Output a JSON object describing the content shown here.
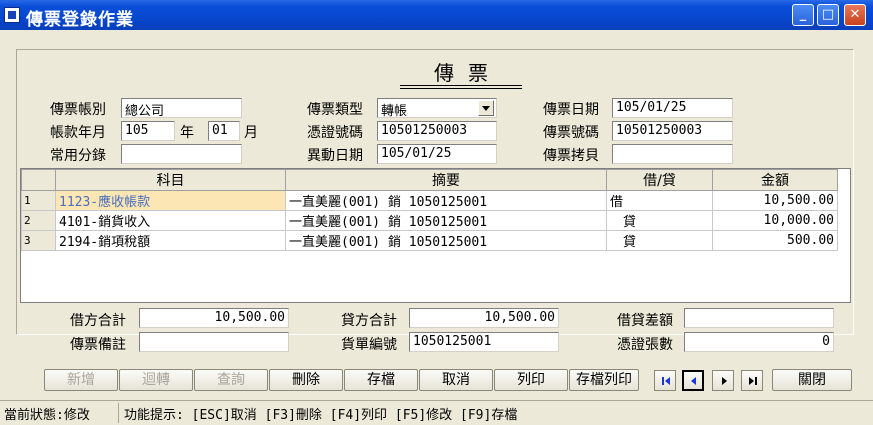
{
  "window": {
    "title": "傳票登錄作業",
    "controls": {
      "minimize": "_",
      "maximize": "□",
      "close": "✕"
    }
  },
  "form": {
    "heading": "傳票",
    "account_type": {
      "label": "傳票帳別",
      "value": "總公司"
    },
    "period": {
      "label": "帳款年月",
      "year": "105",
      "year_unit": "年",
      "month": "01",
      "month_unit": "月"
    },
    "common_entry": {
      "label": "常用分錄",
      "value": ""
    },
    "voucher_kind": {
      "label": "傳票類型",
      "value": "轉帳"
    },
    "proof_no": {
      "label": "憑證號碼",
      "value": "10501250003"
    },
    "change_date": {
      "label": "異動日期",
      "value": "105/01/25"
    },
    "voucher_date": {
      "label": "傳票日期",
      "value": "105/01/25"
    },
    "voucher_no": {
      "label": "傳票號碼",
      "value": "10501250003"
    },
    "voucher_copy": {
      "label": "傳票拷貝",
      "value": ""
    }
  },
  "grid": {
    "columns": [
      "科目",
      "摘要",
      "借/貸",
      "金額"
    ],
    "rows": [
      {
        "n": "1",
        "subject": "1123-應收帳款",
        "summary": "一直美麗(001) 銷 1050125001",
        "dc": "借",
        "amount": "10,500.00"
      },
      {
        "n": "2",
        "subject": "4101-銷貨收入",
        "summary": "一直美麗(001) 銷 1050125001",
        "dc": "　貸",
        "amount": "10,000.00"
      },
      {
        "n": "3",
        "subject": "2194-銷項稅額",
        "summary": "一直美麗(001) 銷 1050125001",
        "dc": "　貸",
        "amount": "500.00"
      }
    ]
  },
  "totals": {
    "debit": {
      "label": "借方合計",
      "value": "10,500.00"
    },
    "credit": {
      "label": "貸方合計",
      "value": "10,500.00"
    },
    "diff": {
      "label": "借貸差額",
      "value": ""
    },
    "remark": {
      "label": "傳票備註",
      "value": ""
    },
    "invoice_no": {
      "label": "貨單編號",
      "value": "1050125001"
    },
    "proof_count": {
      "label": "憑證張數",
      "value": "0"
    }
  },
  "toolbar": {
    "add": "新增",
    "reverse": "迴轉",
    "query": "查詢",
    "delete": "刪除",
    "save": "存檔",
    "cancel": "取消",
    "print": "列印",
    "save_print": "存檔列印",
    "close": "關閉"
  },
  "status": {
    "state": "當前狀態:修改",
    "hint": "功能提示: [ESC]取消 [F3]刪除 [F4]列印 [F5]修改 [F9]存檔"
  }
}
